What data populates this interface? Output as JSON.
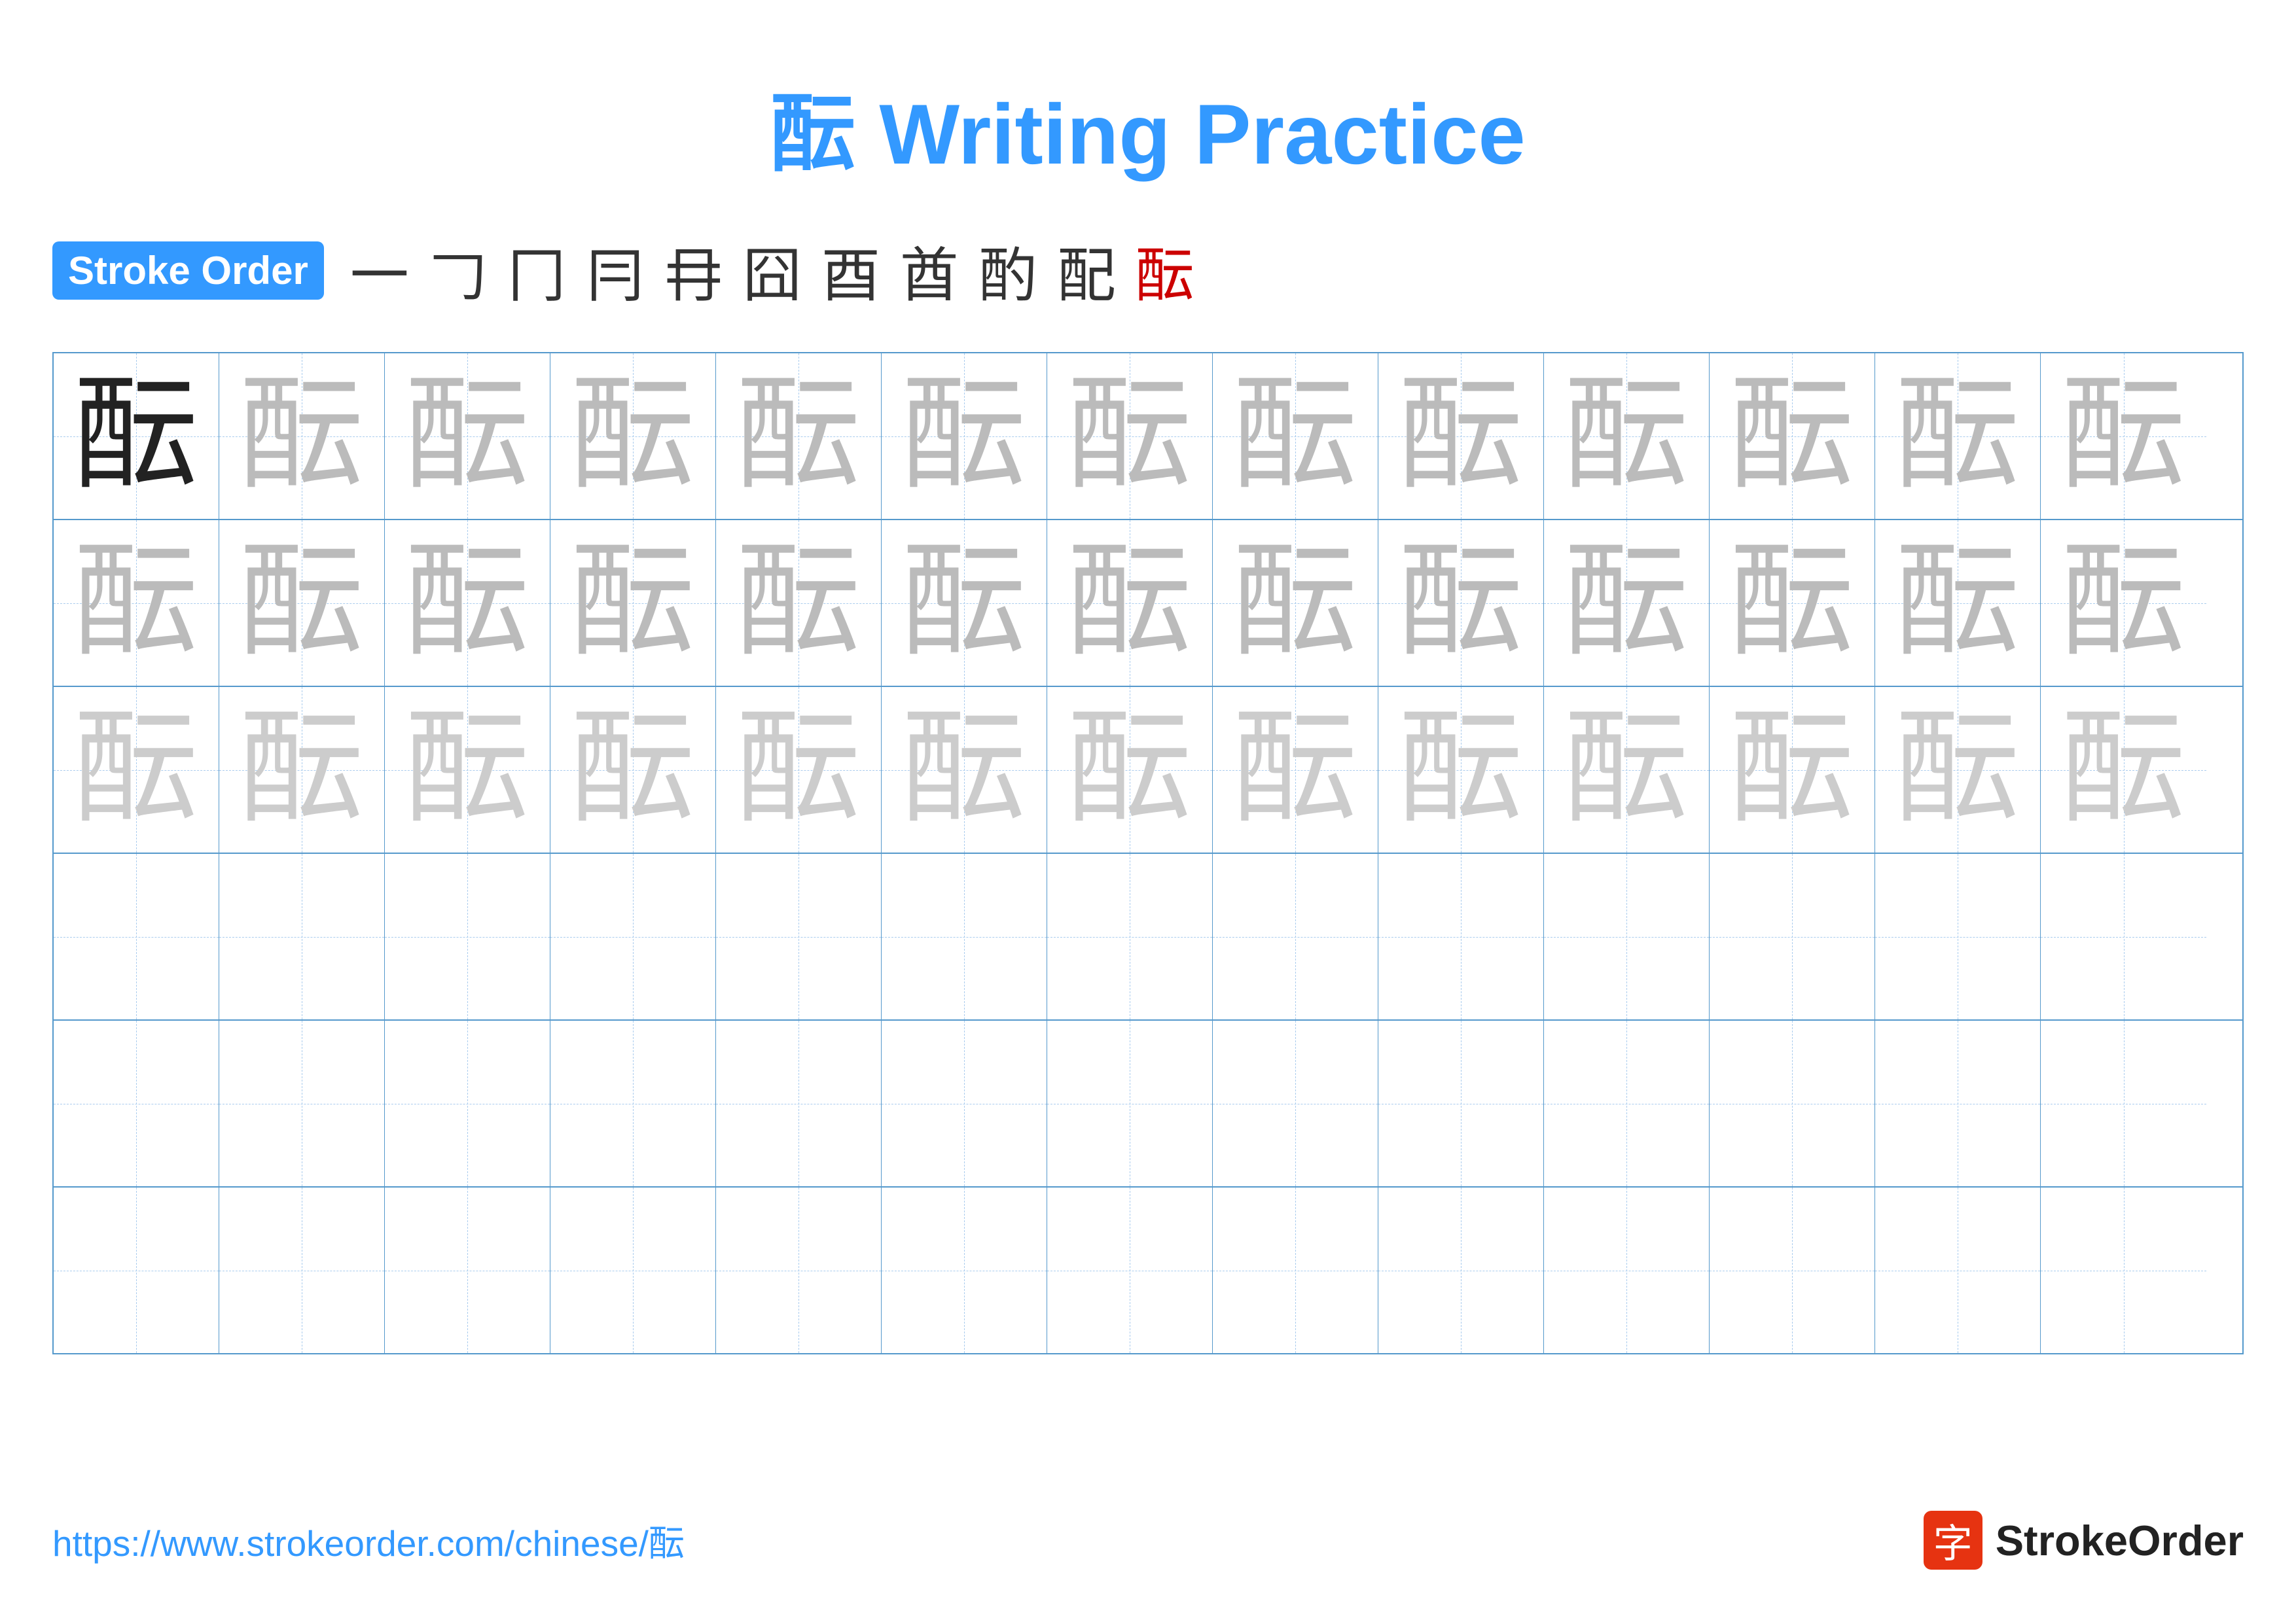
{
  "title": "酝 Writing Practice",
  "stroke_order": {
    "badge_label": "Stroke Order",
    "strokes": [
      "一",
      "𠃌",
      "冂",
      "冃",
      "冄",
      "囧",
      "酉",
      "酋",
      "酌",
      "配",
      "酝"
    ]
  },
  "character": "酝",
  "grid": {
    "cols": 13,
    "rows": 6,
    "row_types": [
      "dark-guide",
      "medium-guide",
      "light-guide",
      "empty",
      "empty",
      "empty"
    ]
  },
  "footer": {
    "url": "https://www.strokeorder.com/chinese/酝",
    "logo_char": "字",
    "logo_name": "StrokeOrder"
  }
}
